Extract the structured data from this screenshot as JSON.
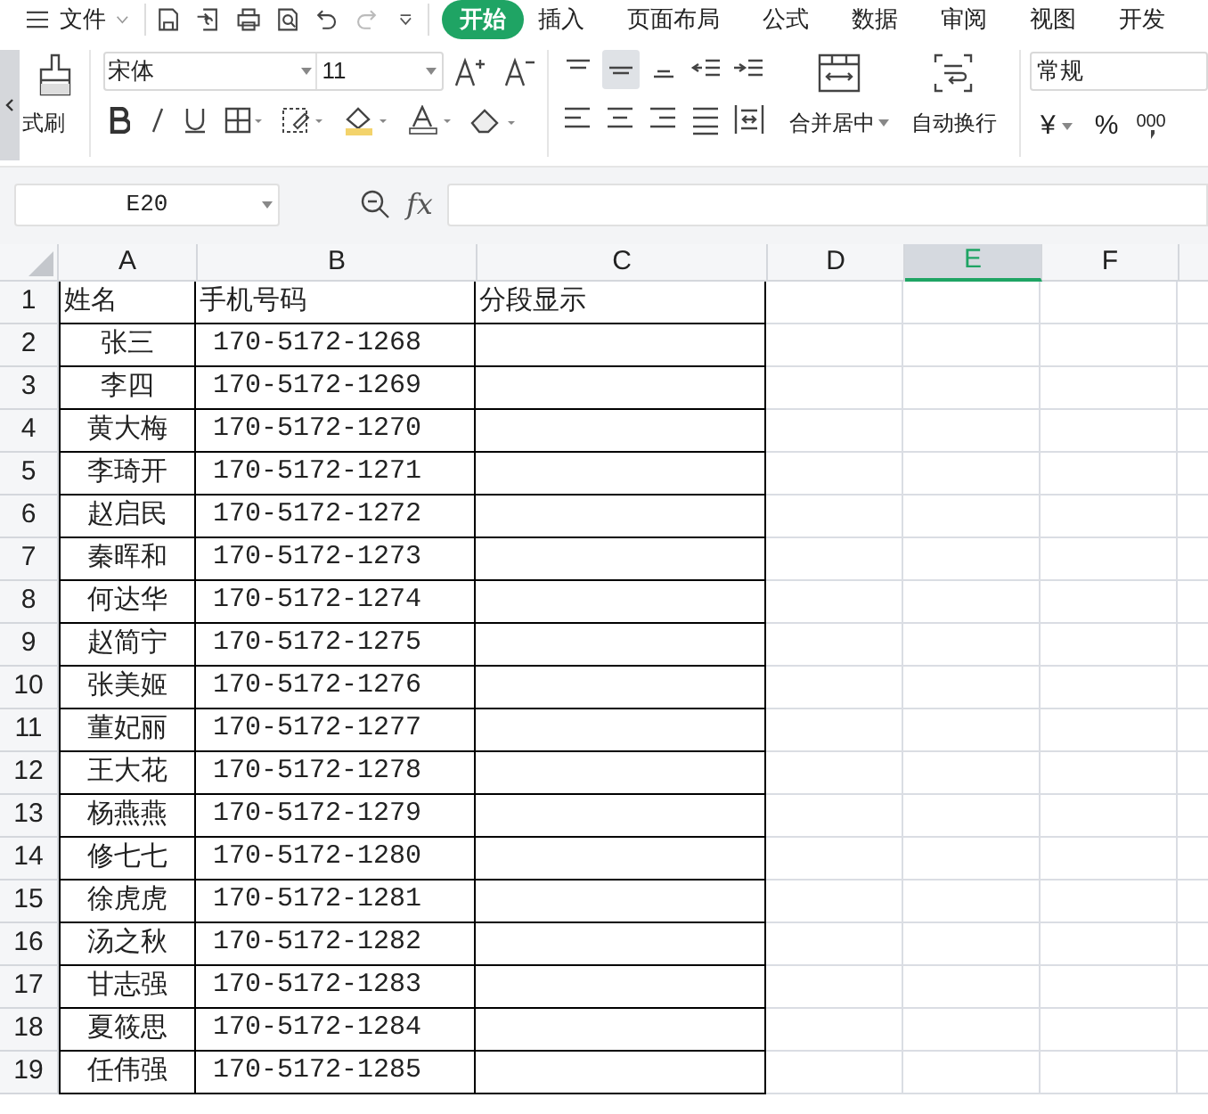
{
  "menu": {
    "file": "文件"
  },
  "tabs": [
    {
      "label": "开始",
      "selected": true
    },
    {
      "label": "插入",
      "selected": false
    },
    {
      "label": "页面布局",
      "selected": false
    },
    {
      "label": "公式",
      "selected": false
    },
    {
      "label": "数据",
      "selected": false
    },
    {
      "label": "审阅",
      "selected": false
    },
    {
      "label": "视图",
      "selected": false
    },
    {
      "label": "开发",
      "selected": false
    }
  ],
  "ribbon": {
    "format_painter": "式刷",
    "font": "宋体",
    "font_size": "11",
    "merge": "合并居中",
    "wrap": "自动换行",
    "number_format": "常规",
    "currency": "¥",
    "percent": "%",
    "thousands": "000"
  },
  "formula_bar": {
    "name_box": "E20",
    "fx": "fx"
  },
  "columns": [
    {
      "label": "A",
      "selected": false
    },
    {
      "label": "B",
      "selected": false
    },
    {
      "label": "C",
      "selected": false
    },
    {
      "label": "D",
      "selected": false
    },
    {
      "label": "E",
      "selected": true
    },
    {
      "label": "F",
      "selected": false
    }
  ],
  "header_row": {
    "number": "1",
    "cells": [
      "姓名",
      "手机号码",
      "分段显示"
    ]
  },
  "rows": [
    {
      "number": "2",
      "name": "张三",
      "phone": "170-5172-1268"
    },
    {
      "number": "3",
      "name": "李四",
      "phone": "170-5172-1269"
    },
    {
      "number": "4",
      "name": "黄大梅",
      "phone": "170-5172-1270"
    },
    {
      "number": "5",
      "name": "李琦开",
      "phone": "170-5172-1271"
    },
    {
      "number": "6",
      "name": "赵启民",
      "phone": "170-5172-1272"
    },
    {
      "number": "7",
      "name": "秦晖和",
      "phone": "170-5172-1273"
    },
    {
      "number": "8",
      "name": "何达华",
      "phone": "170-5172-1274"
    },
    {
      "number": "9",
      "name": "赵简宁",
      "phone": "170-5172-1275"
    },
    {
      "number": "10",
      "name": "张美姬",
      "phone": "170-5172-1276"
    },
    {
      "number": "11",
      "name": "董妃丽",
      "phone": "170-5172-1277"
    },
    {
      "number": "12",
      "name": "王大花",
      "phone": "170-5172-1278"
    },
    {
      "number": "13",
      "name": "杨燕燕",
      "phone": "170-5172-1279"
    },
    {
      "number": "14",
      "name": "修七七",
      "phone": "170-5172-1280"
    },
    {
      "number": "15",
      "name": "徐虎虎",
      "phone": "170-5172-1281"
    },
    {
      "number": "16",
      "name": "汤之秋",
      "phone": "170-5172-1282"
    },
    {
      "number": "17",
      "name": "甘志强",
      "phone": "170-5172-1283"
    },
    {
      "number": "18",
      "name": "夏筱思",
      "phone": "170-5172-1284"
    },
    {
      "number": "19",
      "name": "任伟强",
      "phone": "170-5172-1285"
    }
  ]
}
